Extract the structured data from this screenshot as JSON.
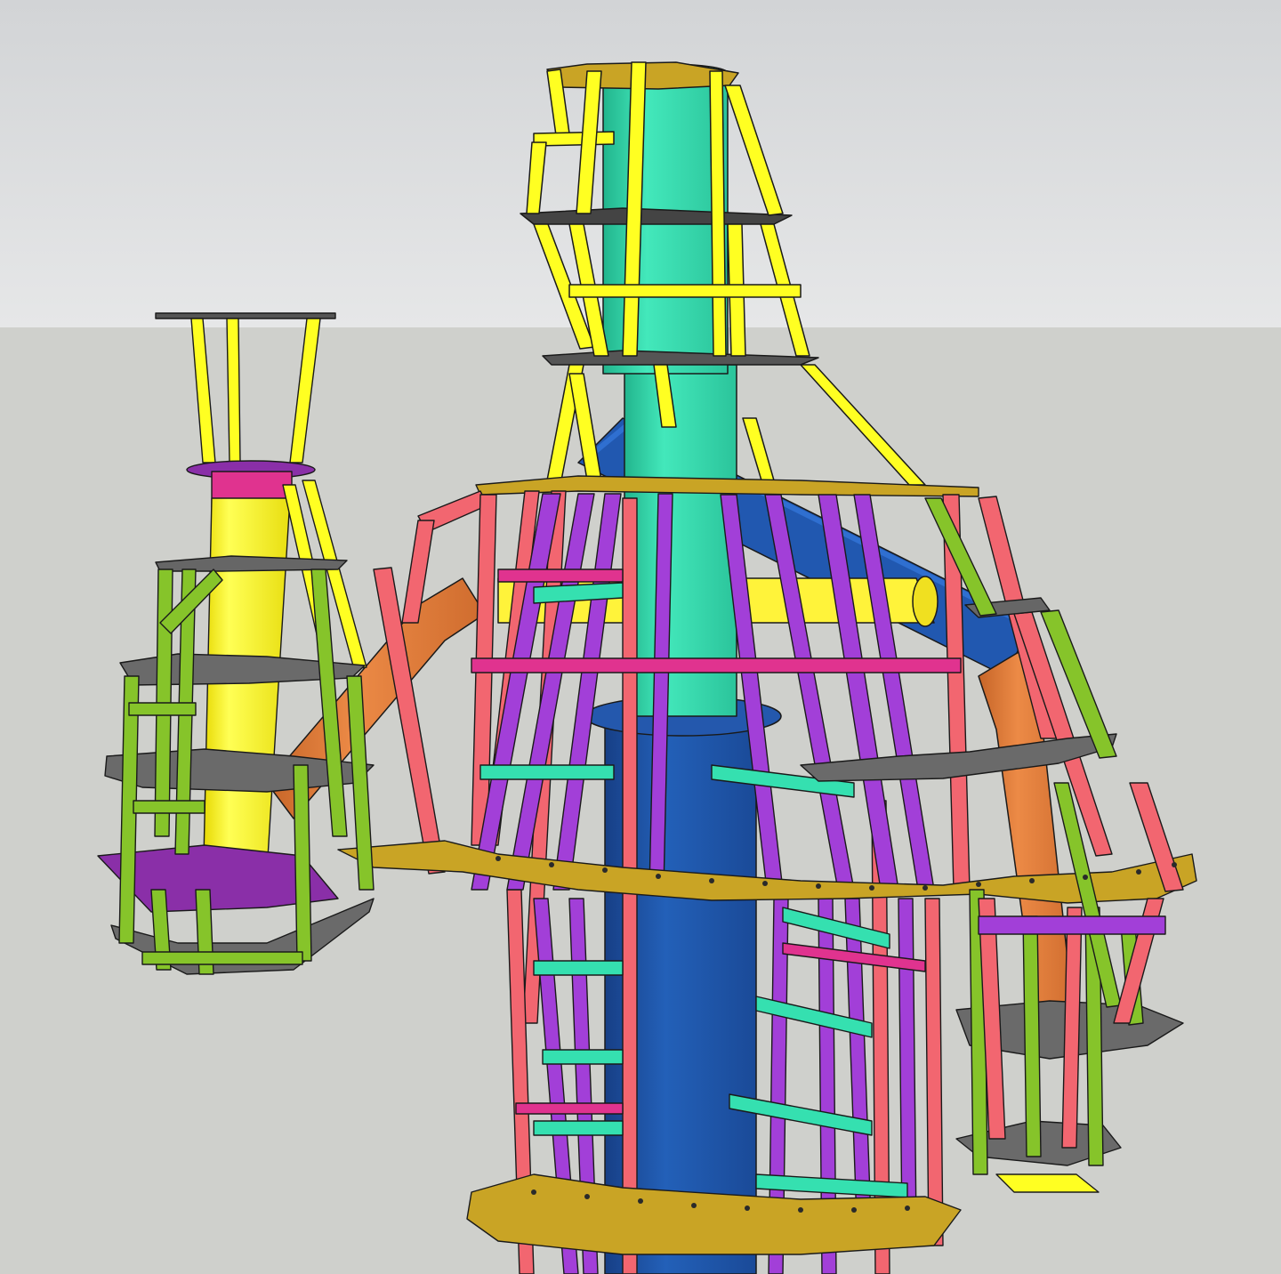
{
  "viewport": {
    "description_visible_text": "",
    "sky_color": "#d4d6d8",
    "ground_color": "#cfd0cc"
  },
  "model": {
    "colors": {
      "central_column_upper": "#35e0b0",
      "central_column_lower": "#1f53a8",
      "yellow_members": "#ffff22",
      "red_members": "#f26670",
      "purple_members": "#a23fd8",
      "green_members": "#86c42a",
      "teal_members": "#35e0b0",
      "orange_tube": "#e07b38",
      "blue_tube": "#1f53a8",
      "magenta_members": "#e0338f",
      "gold_plates": "#c9a425",
      "gray_plates": "#6a6a6a",
      "edge_color": "#1a1a1a"
    },
    "components": [
      "central-column",
      "head-cage",
      "torso-cage",
      "left-arm-cage",
      "right-arm-cage",
      "torch-tube",
      "crossing-tubes"
    ]
  }
}
